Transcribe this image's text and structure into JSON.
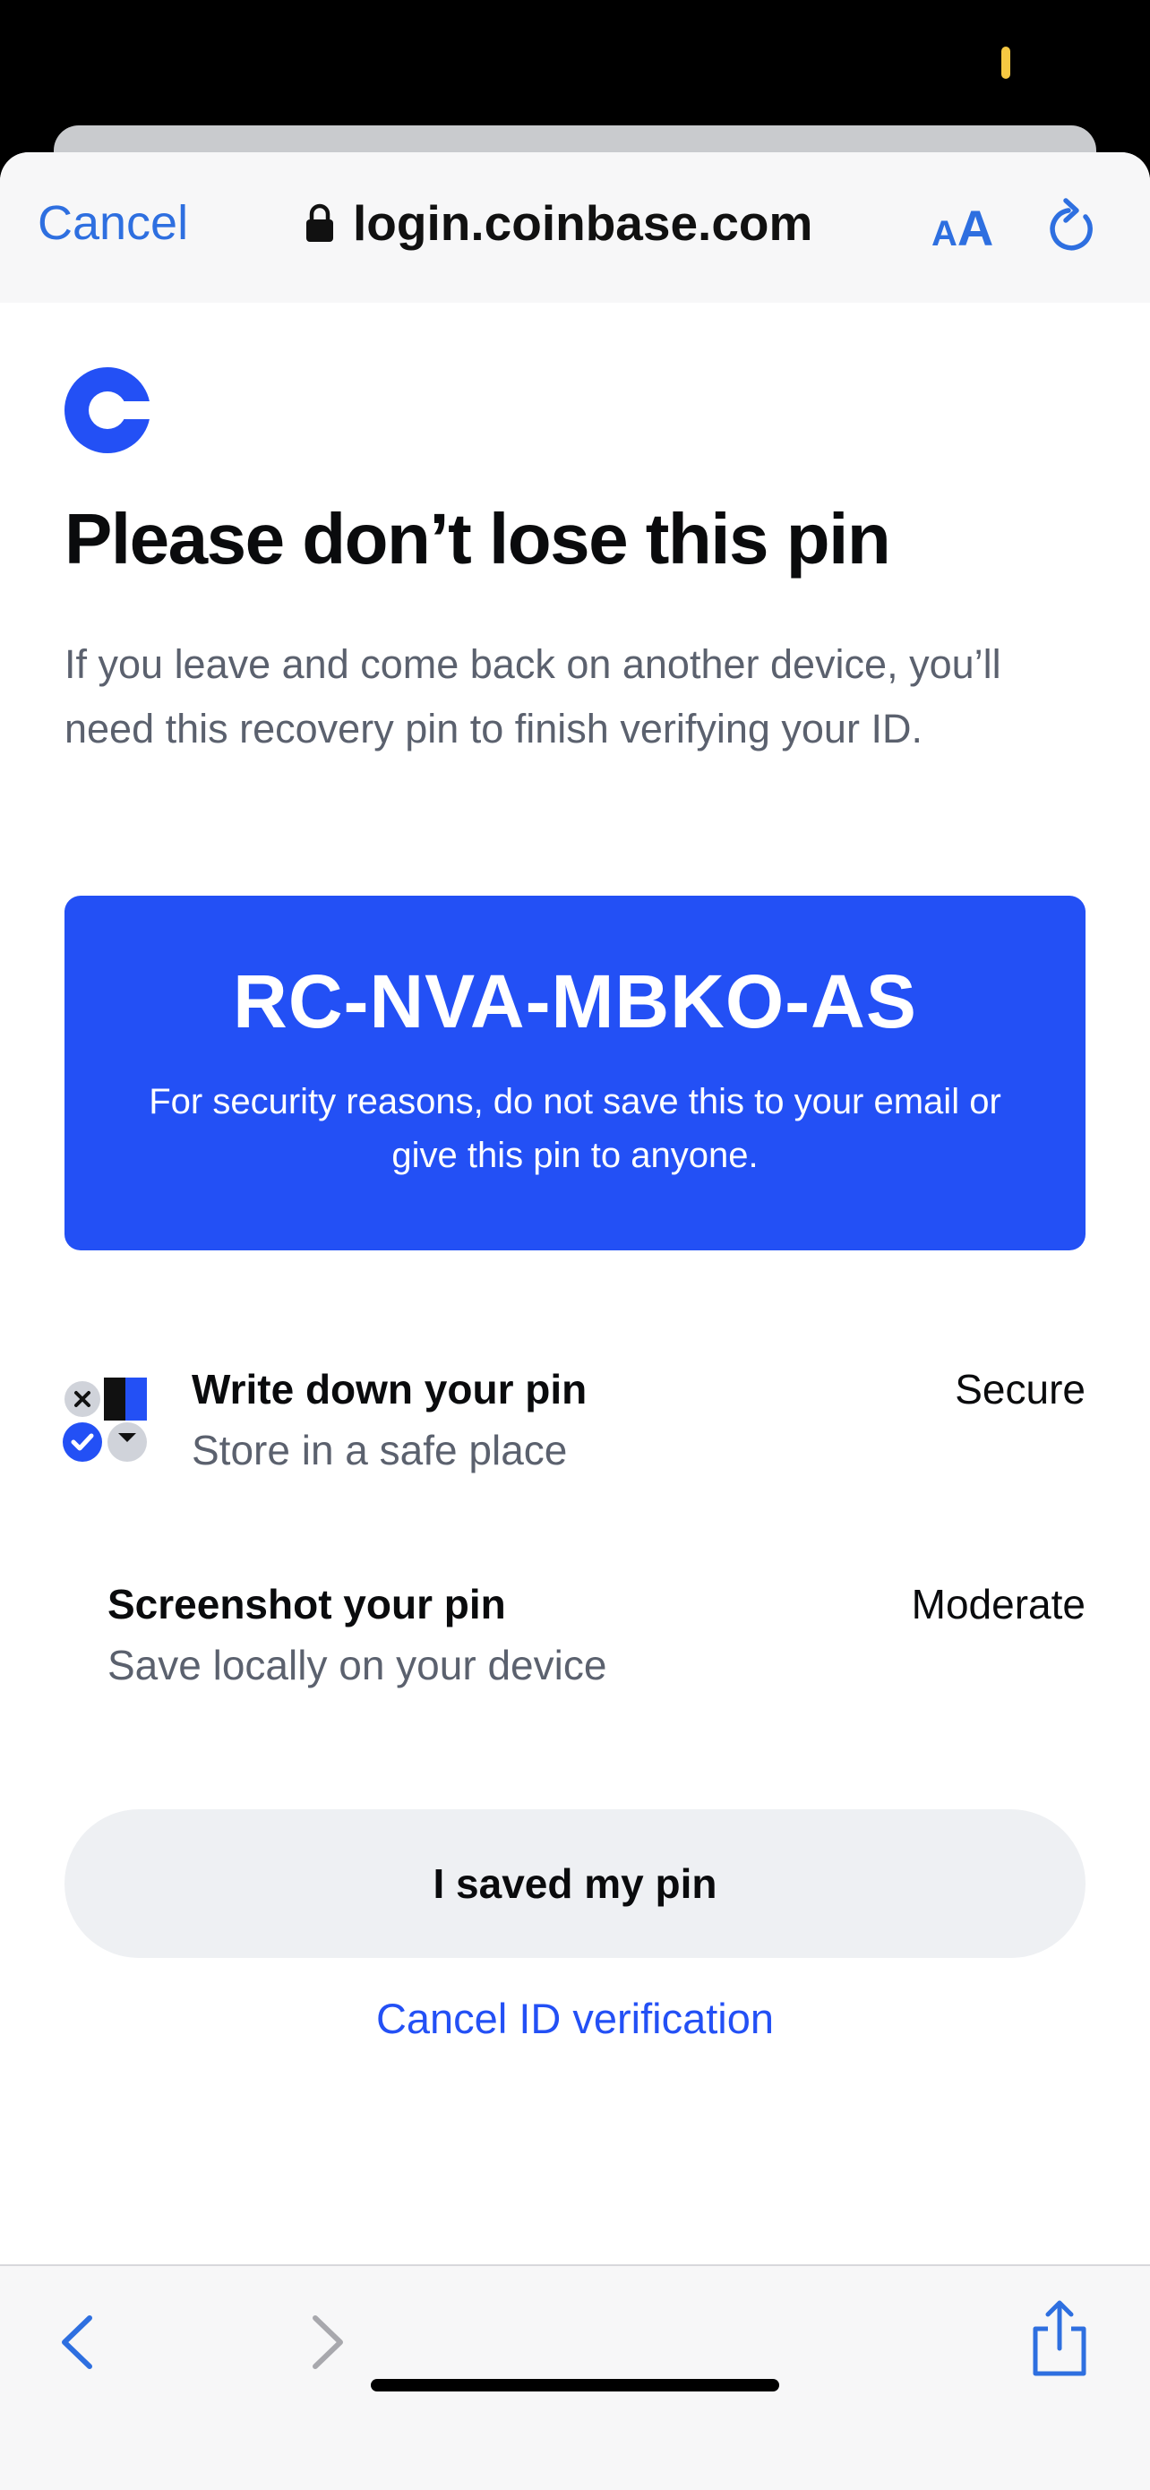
{
  "browser": {
    "cancel_label": "Cancel",
    "url": "login.coinbase.com",
    "text_size_label_small": "A",
    "text_size_label_large": "A"
  },
  "page": {
    "title": "Please don’t lose this pin",
    "description": "If you leave and come back on another device, you’ll need this recovery pin to finish verifying your ID."
  },
  "pin_card": {
    "code": "RC-NVA-MBKO-AS",
    "note": "For security reasons, do not save this to your email or give this pin to anyone."
  },
  "options": [
    {
      "title": "Write down your pin",
      "subtitle": "Store in a safe place",
      "level": "Secure"
    },
    {
      "title": "Screenshot your pin",
      "subtitle": "Save locally on your device",
      "level": "Moderate"
    }
  ],
  "actions": {
    "saved_button": "I saved my pin",
    "cancel_link": "Cancel ID verification"
  },
  "colors": {
    "accent_blue": "#2350f5",
    "ios_blue": "#2e6fe0",
    "text_primary": "#0a0b0d",
    "text_secondary": "#5b616e",
    "button_bg": "#eef0f3"
  },
  "icons": {
    "lock": "lock-icon",
    "text_size": "text-size-icon",
    "reload": "reload-icon",
    "logo": "coinbase-logo-icon",
    "option1": "pin-checklist-icon",
    "back": "chevron-left-icon",
    "forward": "chevron-right-icon",
    "share": "share-icon"
  }
}
